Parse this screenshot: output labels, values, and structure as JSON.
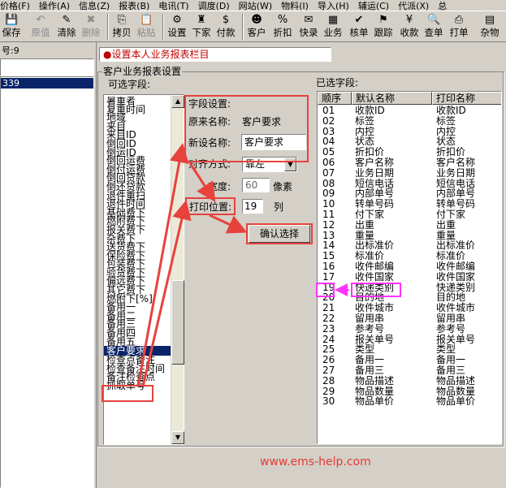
{
  "menu": [
    "价格(F)",
    "操作(A)",
    "信息(Z)",
    "报表(B)",
    "电讯(T)",
    "调度(D)",
    "网站(W)",
    "物料(I)",
    "导入(H)",
    "辅运(C)",
    "代派(X)",
    "总"
  ],
  "toolbar": [
    {
      "label": "保存",
      "icon": "save-icon",
      "enabled": true
    },
    {
      "label": "原值",
      "icon": "undo-icon",
      "enabled": false
    },
    {
      "label": "清除",
      "icon": "clear-icon",
      "enabled": true
    },
    {
      "label": "删除",
      "icon": "delete-icon",
      "enabled": false
    },
    {
      "label": "拷贝",
      "icon": "copy-icon",
      "enabled": true
    },
    {
      "label": "粘贴",
      "icon": "paste-icon",
      "enabled": false
    },
    {
      "label": "设置",
      "icon": "settings-icon",
      "enabled": true
    },
    {
      "label": "下家",
      "icon": "next-party-icon",
      "enabled": true
    },
    {
      "label": "付款",
      "icon": "payment-icon",
      "enabled": true
    },
    {
      "label": "客户",
      "icon": "customer-icon",
      "enabled": true
    },
    {
      "label": "折扣",
      "icon": "discount-icon",
      "enabled": true
    },
    {
      "label": "快录",
      "icon": "quick-entry-icon",
      "enabled": true
    },
    {
      "label": "业务",
      "icon": "business-icon",
      "enabled": true
    },
    {
      "label": "核单",
      "icon": "verify-icon",
      "enabled": true
    },
    {
      "label": "跟踪",
      "icon": "tracking-icon",
      "enabled": true
    },
    {
      "label": "收款",
      "icon": "receipt-icon",
      "enabled": true
    },
    {
      "label": "查单",
      "icon": "query-icon",
      "enabled": true
    },
    {
      "label": "打单",
      "icon": "print-icon",
      "enabled": true
    },
    {
      "label": "杂物",
      "icon": "misc-icon",
      "enabled": true
    }
  ],
  "left": {
    "top_text": "号:9",
    "selected_row": "339"
  },
  "header_bar": "●设置本人业务报表栏目",
  "group_title": "客户业务报表设置",
  "available": {
    "title": "可选字段:",
    "items": [
      "暑重者",
      "复重时间",
      "地域",
      "来目",
      "来目ID",
      "倒回ID",
      "倒运ID",
      "倒回运费",
      "倒付运费",
      "倒回贷款",
      "倒还贷款",
      "退件重扫",
      "退件时间",
      "基础费下",
      "燃附费下",
      "报关费下",
      "杂费下",
      "送货费下",
      "保险费下",
      "包装费下",
      "验货费下",
      "偏远费下",
      "其它费下",
      "燃附下[%]",
      "备用一",
      "备用二",
      "备用三",
      "备用四",
      "备用五",
      "客户要求",
      "检查点备注",
      "检查备注时间",
      "备注检查点",
      "抓取单号"
    ],
    "selected": "客户要求"
  },
  "field_settings": {
    "title": "字段设置:",
    "orig_label": "原来名称:",
    "orig_value": "客户要求",
    "new_label": "新设名称:",
    "new_value": "客户要求",
    "align_label": "对齐方式:",
    "align_value": "靠左",
    "width_label": "宽度:",
    "width_value": "60",
    "width_unit": "像素",
    "pos_label": "打印位置:",
    "pos_value": "19",
    "pos_unit": "列",
    "confirm": "确认选择"
  },
  "selected_fields": {
    "title": "已选字段:",
    "headers": [
      "顺序",
      "默认名称",
      "打印名称"
    ],
    "rows": [
      [
        "01",
        "收款ID",
        "收款ID"
      ],
      [
        "02",
        "标签",
        "标签"
      ],
      [
        "03",
        "内控",
        "内控"
      ],
      [
        "04",
        "状态",
        "状态"
      ],
      [
        "05",
        "折扣价",
        "折扣价"
      ],
      [
        "06",
        "客户名称",
        "客户名称"
      ],
      [
        "07",
        "业务日期",
        "业务日期"
      ],
      [
        "08",
        "短信电话",
        "短信电话"
      ],
      [
        "09",
        "内部单号",
        "内部单号"
      ],
      [
        "10",
        "转单号码",
        "转单号码"
      ],
      [
        "11",
        "付下家",
        "付下家"
      ],
      [
        "12",
        "出重",
        "出重"
      ],
      [
        "13",
        "重量",
        "重量"
      ],
      [
        "14",
        "出标准价",
        "出标准价"
      ],
      [
        "15",
        "标准价",
        "标准价"
      ],
      [
        "16",
        "收件邮编",
        "收件邮编"
      ],
      [
        "17",
        "收件国家",
        "收件国家"
      ],
      [
        "19",
        "快递类别",
        "快递类别"
      ],
      [
        "20",
        "目的地",
        "目的地"
      ],
      [
        "21",
        "收件城市",
        "收件城市"
      ],
      [
        "22",
        "留用串",
        "留用串"
      ],
      [
        "23",
        "参考号",
        "参考号"
      ],
      [
        "24",
        "报关单号",
        "报关单号"
      ],
      [
        "25",
        "类型",
        "类型"
      ],
      [
        "26",
        "备用一",
        "备用一"
      ],
      [
        "27",
        "备用三",
        "备用三"
      ],
      [
        "28",
        "物品描述",
        "物品描述"
      ],
      [
        "29",
        "物品数量",
        "物品数量"
      ],
      [
        "30",
        "物品单价",
        "物品单价"
      ]
    ]
  },
  "watermark": "www.ems-help.com",
  "colors": {
    "accent_red": "#e8423c",
    "highlight_magenta": "#ff33ff",
    "selection": "#0a246a",
    "watermark": "#e53935"
  }
}
